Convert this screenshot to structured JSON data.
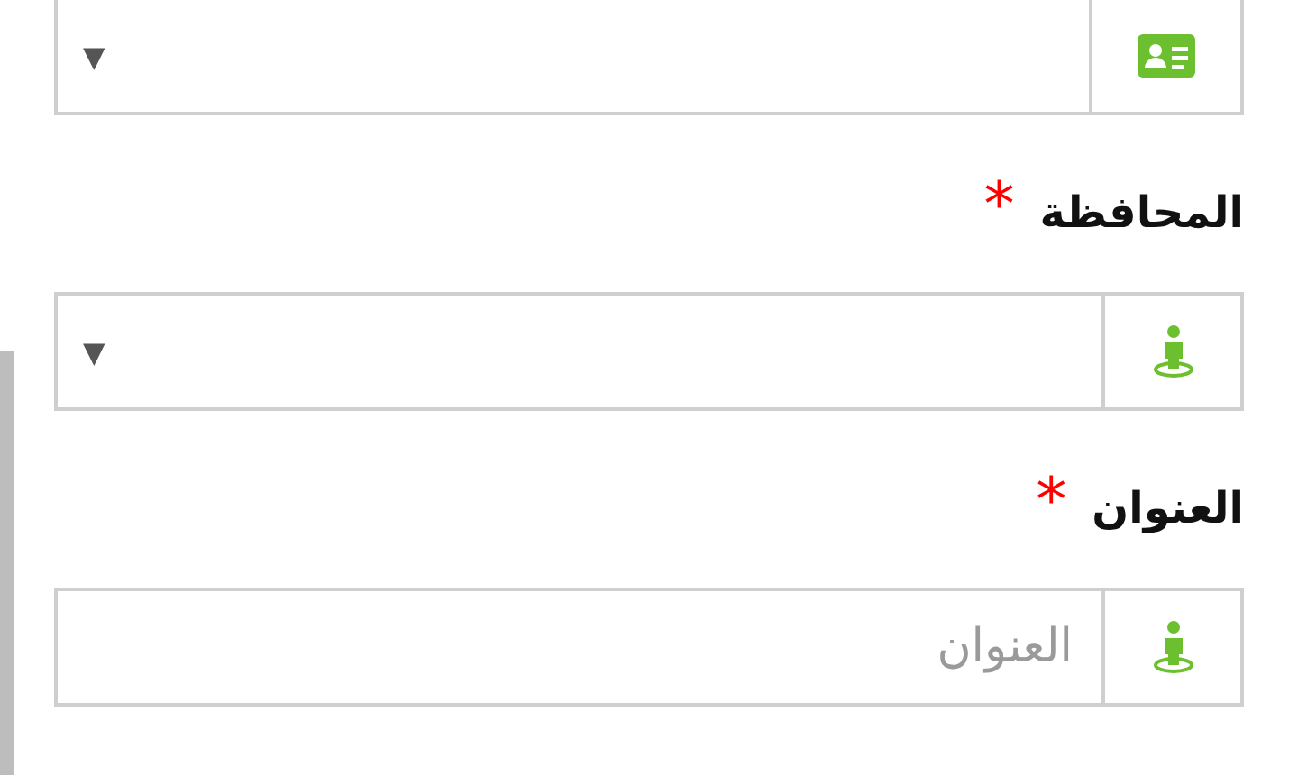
{
  "fields": [
    {
      "kind": "select",
      "arrow": "▼"
    },
    {
      "kind": "select",
      "label": "المحافظة",
      "required_mark": "*",
      "arrow": "▼"
    },
    {
      "kind": "text",
      "label": "العنوان",
      "required_mark": "*",
      "placeholder": "العنوان"
    }
  ]
}
